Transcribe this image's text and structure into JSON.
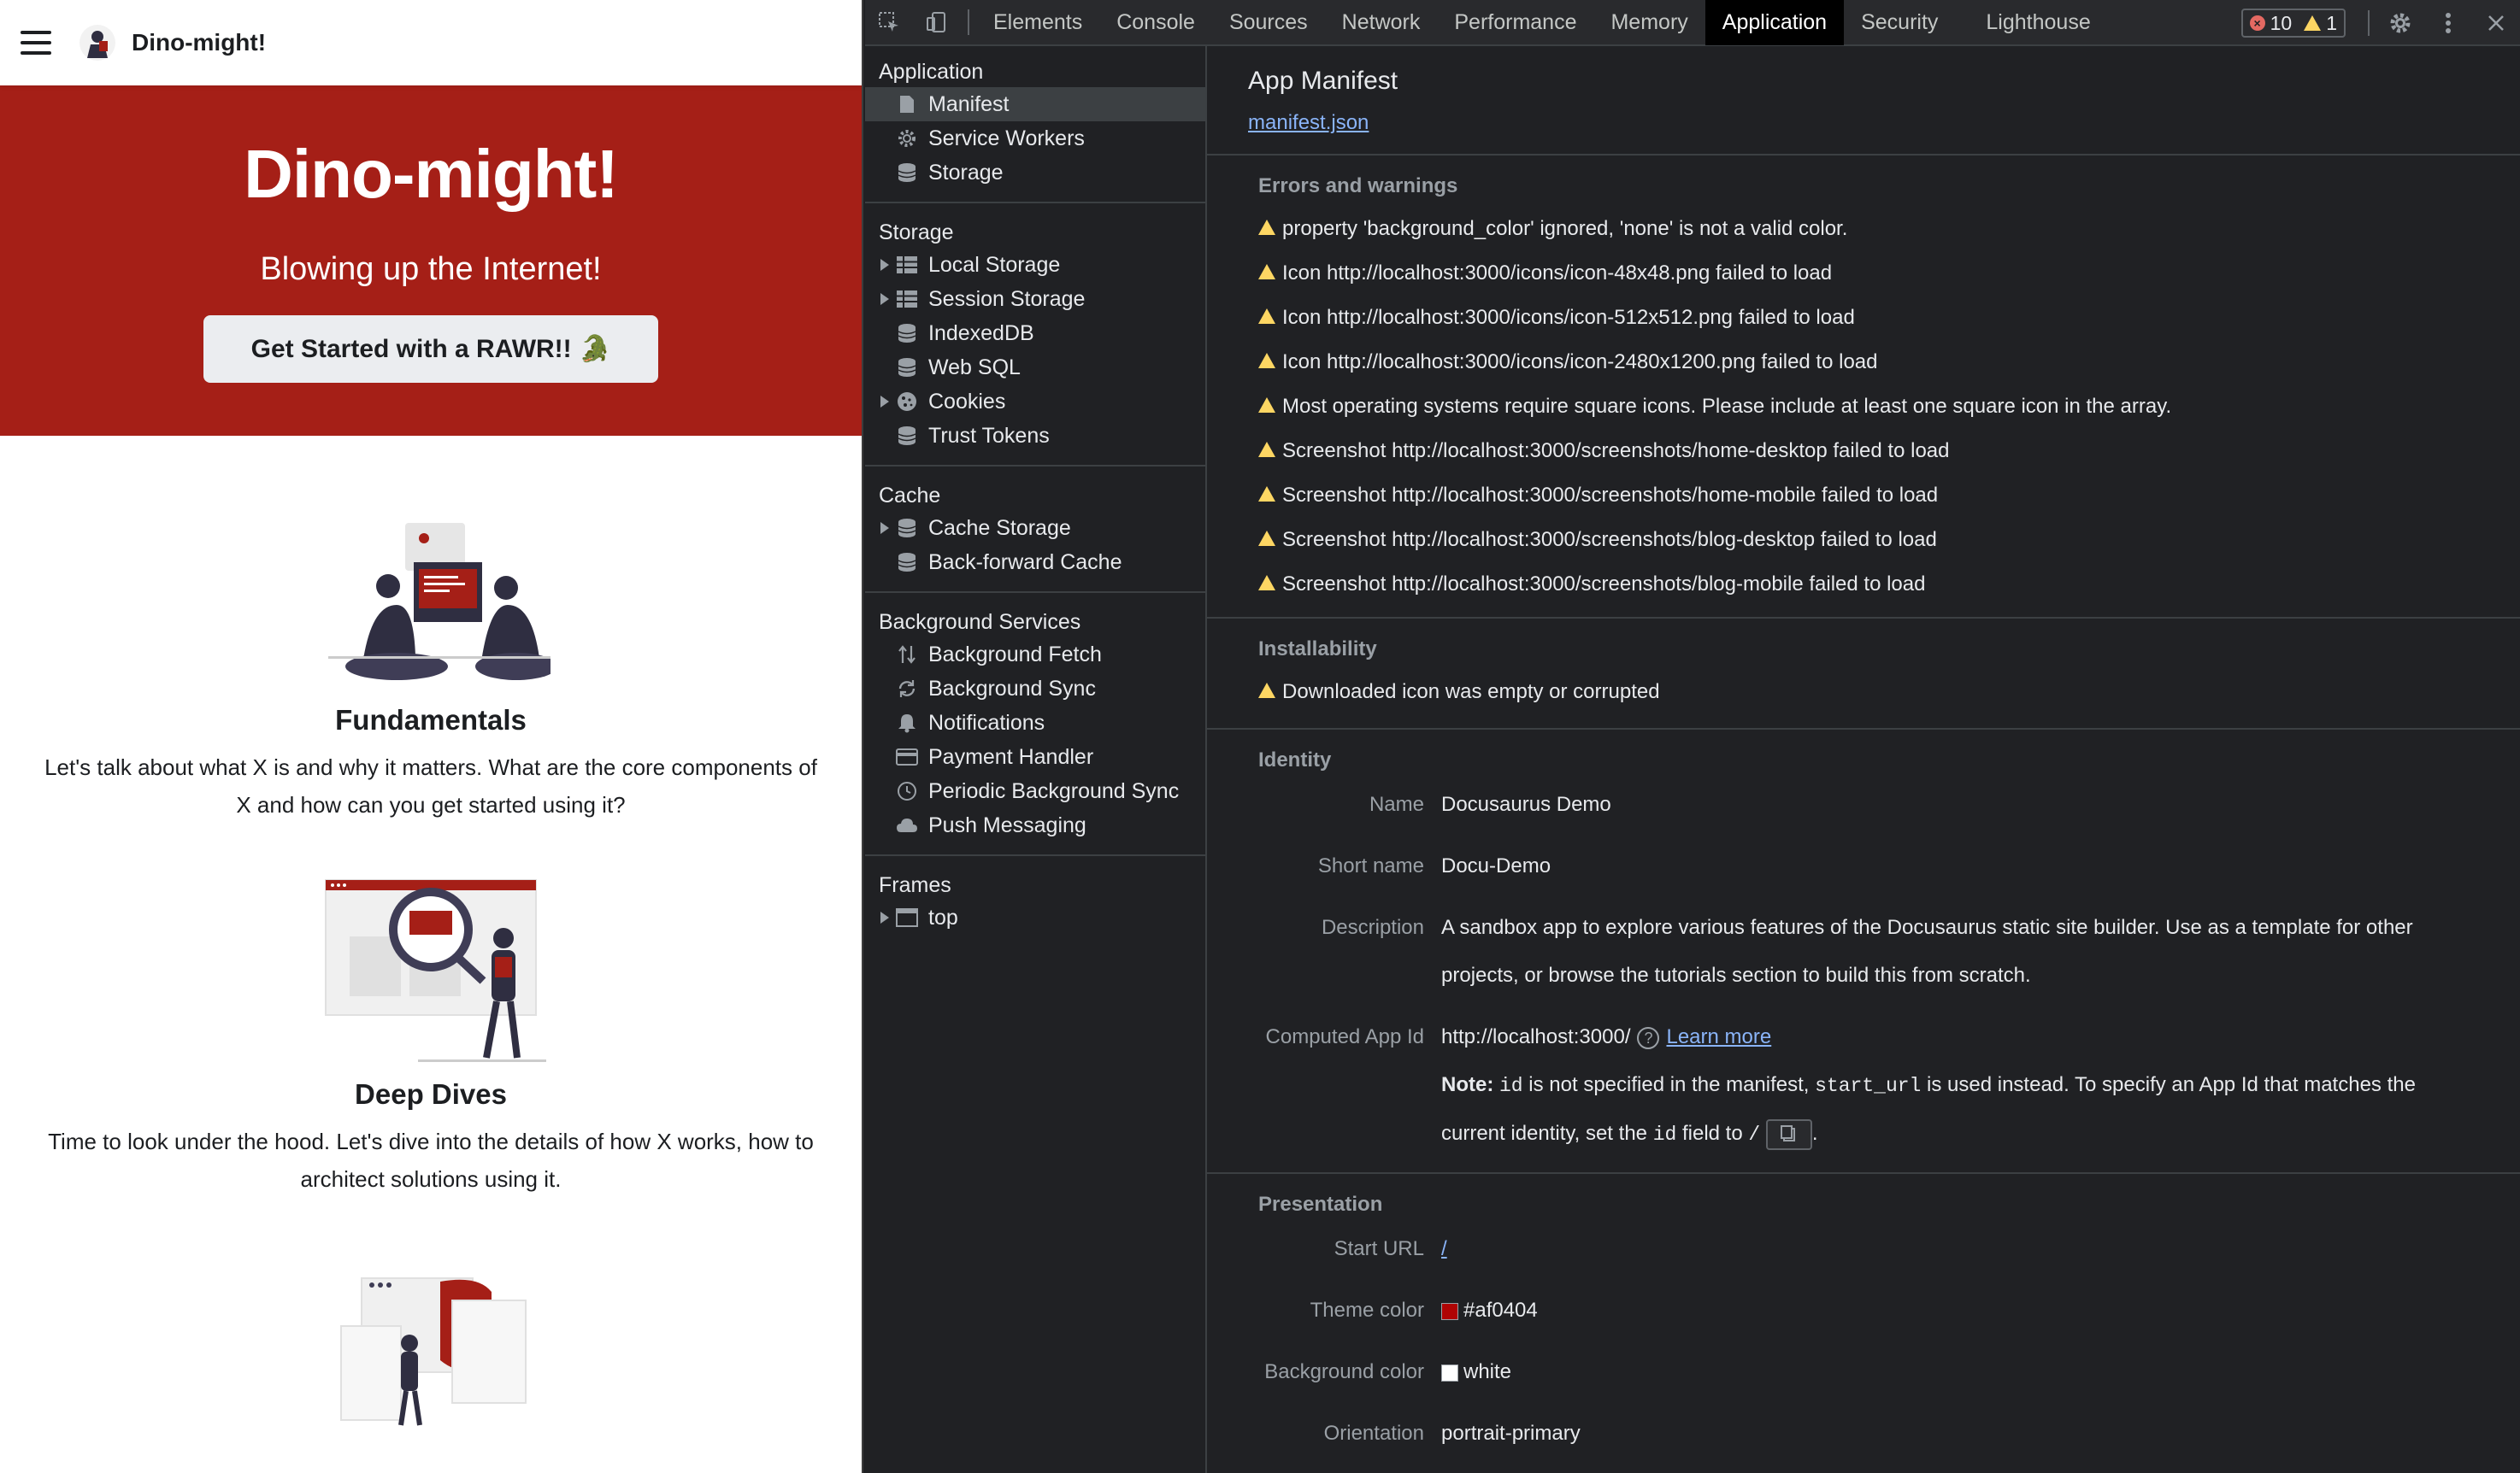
{
  "site": {
    "nav_title": "Dino-might!",
    "hero_title": "Dino-might!",
    "hero_tagline": "Blowing up the Internet!",
    "cta_label": "Get Started with a RAWR!! 🐊",
    "features": [
      {
        "title": "Fundamentals",
        "text": "Let's talk about what X is and why it matters. What are the core components of X and how can you get started using it?"
      },
      {
        "title": "Deep Dives",
        "text": "Time to look under the hood. Let's dive into the details of how X works, how to architect solutions using it."
      }
    ]
  },
  "devtools": {
    "tabs": [
      "Elements",
      "Console",
      "Sources",
      "Network",
      "Performance",
      "Memory",
      "Application",
      "Security",
      "Lighthouse"
    ],
    "active_tab": "Application",
    "error_count": "10",
    "warning_count": "1",
    "sidebar": {
      "application": {
        "title": "Application",
        "items": [
          "Manifest",
          "Service Workers",
          "Storage"
        ]
      },
      "storage": {
        "title": "Storage",
        "items": [
          "Local Storage",
          "Session Storage",
          "IndexedDB",
          "Web SQL",
          "Cookies",
          "Trust Tokens"
        ]
      },
      "cache": {
        "title": "Cache",
        "items": [
          "Cache Storage",
          "Back-forward Cache"
        ]
      },
      "background": {
        "title": "Background Services",
        "items": [
          "Background Fetch",
          "Background Sync",
          "Notifications",
          "Payment Handler",
          "Periodic Background Sync",
          "Push Messaging"
        ]
      },
      "frames": {
        "title": "Frames",
        "items": [
          "top"
        ]
      }
    },
    "manifest": {
      "title": "App Manifest",
      "link": "manifest.json",
      "errors_title": "Errors and warnings",
      "warnings": [
        "property 'background_color' ignored, 'none' is not a valid color.",
        "Icon http://localhost:3000/icons/icon-48x48.png failed to load",
        "Icon http://localhost:3000/icons/icon-512x512.png failed to load",
        "Icon http://localhost:3000/icons/icon-2480x1200.png failed to load",
        "Most operating systems require square icons. Please include at least one square icon in the array.",
        "Screenshot http://localhost:3000/screenshots/home-desktop failed to load",
        "Screenshot http://localhost:3000/screenshots/home-mobile failed to load",
        "Screenshot http://localhost:3000/screenshots/blog-desktop failed to load",
        "Screenshot http://localhost:3000/screenshots/blog-mobile failed to load"
      ],
      "installability_title": "Installability",
      "installability_warning": "Downloaded icon was empty or corrupted",
      "identity_title": "Identity",
      "identity": {
        "name_label": "Name",
        "name": "Docusaurus Demo",
        "short_name_label": "Short name",
        "short_name": "Docu-Demo",
        "description_label": "Description",
        "description": "A sandbox app to explore various features of the Docusaurus static site builder. Use as a template for other projects, or browse the tutorials section to build  this from scratch.",
        "app_id_label": "Computed App Id",
        "app_id": "http://localhost:3000/",
        "learn_more": "Learn more",
        "note_bold": "Note:",
        "note_code_id": "id",
        "note_text_1": "is not specified in the manifest,",
        "note_code_start": "start_url",
        "note_text_2": "is used instead. To specify an App Id that matches the current identity, set the",
        "note_code_id2": "id",
        "note_text_3": "field to",
        "note_code_slash": "/",
        "note_end": "."
      },
      "presentation_title": "Presentation",
      "presentation": {
        "start_url_label": "Start URL",
        "start_url": "/",
        "theme_color_label": "Theme color",
        "theme_color": "#af0404",
        "bg_color_label": "Background color",
        "bg_color": "white",
        "orientation_label": "Orientation",
        "orientation": "portrait-primary"
      }
    }
  },
  "colors": {
    "brand_red": "#a51f17",
    "theme_swatch": "#af0404",
    "link_blue": "#8ab4f8",
    "warning_yellow": "#fdd663"
  }
}
